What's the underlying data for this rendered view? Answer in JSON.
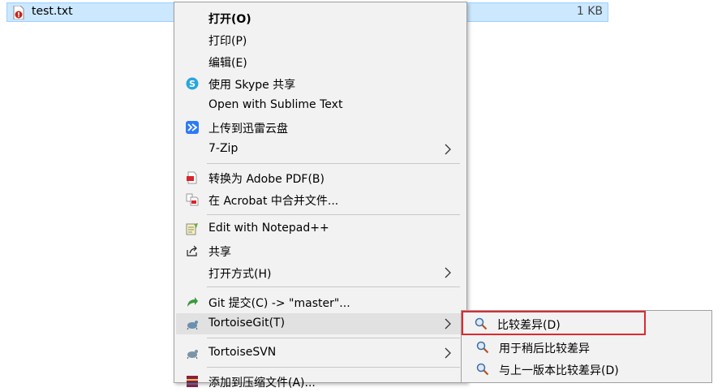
{
  "file": {
    "name": "test.txt",
    "size": "1 KB"
  },
  "menu": {
    "items": [
      {
        "label": "打开(O)",
        "icon": "none"
      },
      {
        "label": "打印(P)",
        "icon": "none"
      },
      {
        "label": "编辑(E)",
        "icon": "none"
      },
      {
        "label": "使用 Skype 共享",
        "icon": "skype-icon"
      },
      {
        "label": "Open with Sublime Text",
        "icon": "none"
      },
      {
        "label": "上传到迅雷云盘",
        "icon": "xunlei-icon"
      },
      {
        "label": "7-Zip",
        "icon": "none"
      },
      {
        "label": "转换为 Adobe PDF(B)",
        "icon": "adobe-pdf-icon"
      },
      {
        "label": "在 Acrobat 中合并文件...",
        "icon": "acrobat-combine-icon"
      },
      {
        "label": "Edit with Notepad++",
        "icon": "notepad-plus-icon"
      },
      {
        "label": "共享",
        "icon": "share-icon"
      },
      {
        "label": "打开方式(H)",
        "icon": "none"
      },
      {
        "label": "Git 提交(C) -> \"master\"...",
        "icon": "git-commit-icon"
      },
      {
        "label": "TortoiseGit(T)",
        "icon": "tortoisegit-icon"
      },
      {
        "label": "TortoiseSVN",
        "icon": "tortoisesvn-icon"
      },
      {
        "label": "添加到压缩文件(A)...",
        "icon": "winrar-icon"
      }
    ]
  },
  "submenu": {
    "items": [
      {
        "label": "比较差异(D)",
        "icon": "magnifier-icon"
      },
      {
        "label": "用于稍后比较差异",
        "icon": "magnifier-icon"
      },
      {
        "label": "与上一版本比较差异(D)",
        "icon": "magnifier-icon"
      }
    ]
  },
  "colors": {
    "selection": "#cce8ff",
    "menu_bg": "#f2f2f2",
    "highlight": "#e1e1e1",
    "callout_border": "#e0282e"
  }
}
